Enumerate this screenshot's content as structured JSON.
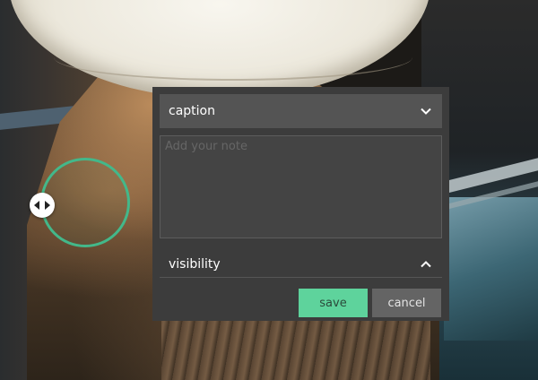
{
  "dropdown": {
    "label": "caption",
    "icon": "chevron-down-icon"
  },
  "note": {
    "placeholder": "Add your note",
    "value": ""
  },
  "visibility": {
    "label": "visibility",
    "icon": "chevron-up-icon"
  },
  "actions": {
    "save_label": "save",
    "cancel_label": "cancel"
  },
  "colors": {
    "accent": "#5ed39c",
    "ring": "#43b88a",
    "panel": "#3c3c3c",
    "dropdown": "#545454",
    "cancel": "#646464"
  }
}
